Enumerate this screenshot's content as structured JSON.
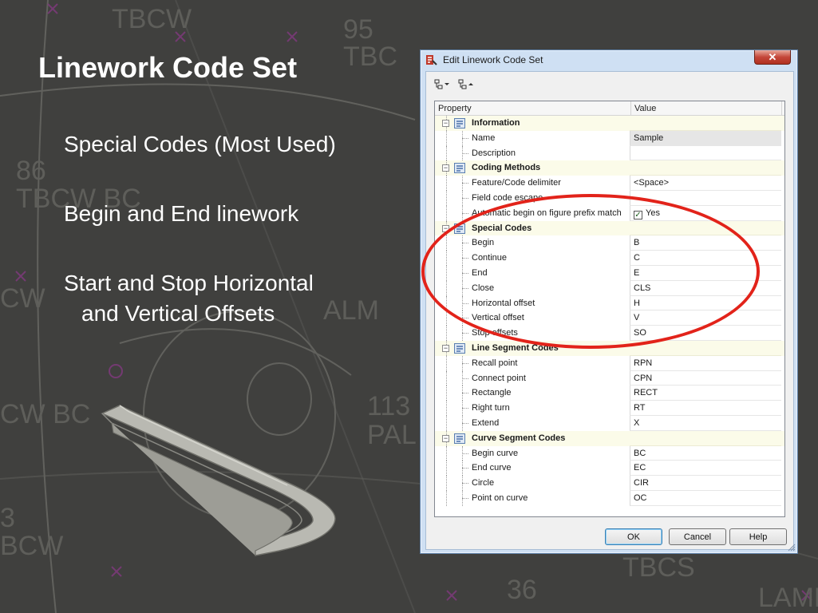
{
  "slide": {
    "title": "Linework Code Set",
    "bullets": [
      "Special Codes  (Most Used)",
      "Begin and End linework",
      "Start and Stop Horizontal",
      "and Vertical Offsets"
    ]
  },
  "background_labels": [
    "TBCW",
    "95",
    "TBC",
    "86",
    "TBCW BC",
    "CW",
    "ALM",
    "CW BC",
    "113",
    "PAL",
    "3",
    "BCW",
    "TBCS",
    "36",
    "LAMP"
  ],
  "dialog": {
    "title": "Edit Linework Code Set",
    "close_symbol": "✕",
    "toolbar": {
      "expand_icon": "expand-all-icon",
      "collapse_icon": "collapse-all-icon"
    },
    "columns": {
      "property": "Property",
      "value": "Value"
    },
    "rows": [
      {
        "type": "category",
        "property": "Information",
        "value": ""
      },
      {
        "type": "item",
        "property": "Name",
        "value": "Sample",
        "selected": true
      },
      {
        "type": "item",
        "property": "Description",
        "value": ""
      },
      {
        "type": "category",
        "property": "Coding Methods",
        "value": ""
      },
      {
        "type": "item",
        "property": "Feature/Code delimiter",
        "value": "<Space>"
      },
      {
        "type": "item",
        "property": "Field code escape",
        "value": ""
      },
      {
        "type": "item",
        "property": "Automatic begin on figure prefix match",
        "value": "Yes",
        "checkbox": true
      },
      {
        "type": "category",
        "property": "Special Codes",
        "value": ""
      },
      {
        "type": "item",
        "property": "Begin",
        "value": "B"
      },
      {
        "type": "item",
        "property": "Continue",
        "value": "C"
      },
      {
        "type": "item",
        "property": "End",
        "value": "E"
      },
      {
        "type": "item",
        "property": "Close",
        "value": "CLS"
      },
      {
        "type": "item",
        "property": "Horizontal offset",
        "value": "H"
      },
      {
        "type": "item",
        "property": "Vertical offset",
        "value": "V"
      },
      {
        "type": "item",
        "property": "Stop offsets",
        "value": "SO"
      },
      {
        "type": "category",
        "property": "Line Segment Codes",
        "value": ""
      },
      {
        "type": "item",
        "property": "Recall point",
        "value": "RPN"
      },
      {
        "type": "item",
        "property": "Connect point",
        "value": "CPN"
      },
      {
        "type": "item",
        "property": "Rectangle",
        "value": "RECT"
      },
      {
        "type": "item",
        "property": "Right turn",
        "value": "RT"
      },
      {
        "type": "item",
        "property": "Extend",
        "value": "X"
      },
      {
        "type": "category",
        "property": "Curve Segment Codes",
        "value": ""
      },
      {
        "type": "item",
        "property": "Begin curve",
        "value": "BC"
      },
      {
        "type": "item",
        "property": "End curve",
        "value": "EC"
      },
      {
        "type": "item",
        "property": "Circle",
        "value": "CIR"
      },
      {
        "type": "item",
        "property": "Point on curve",
        "value": "OC"
      }
    ],
    "buttons": {
      "ok": "OK",
      "cancel": "Cancel",
      "help": "Help"
    }
  },
  "colors": {
    "highlight": "#e2231a",
    "title_text": "#ffffff",
    "dialog_frame": "#cfe0f3",
    "category_row": "#fbfbe9"
  }
}
